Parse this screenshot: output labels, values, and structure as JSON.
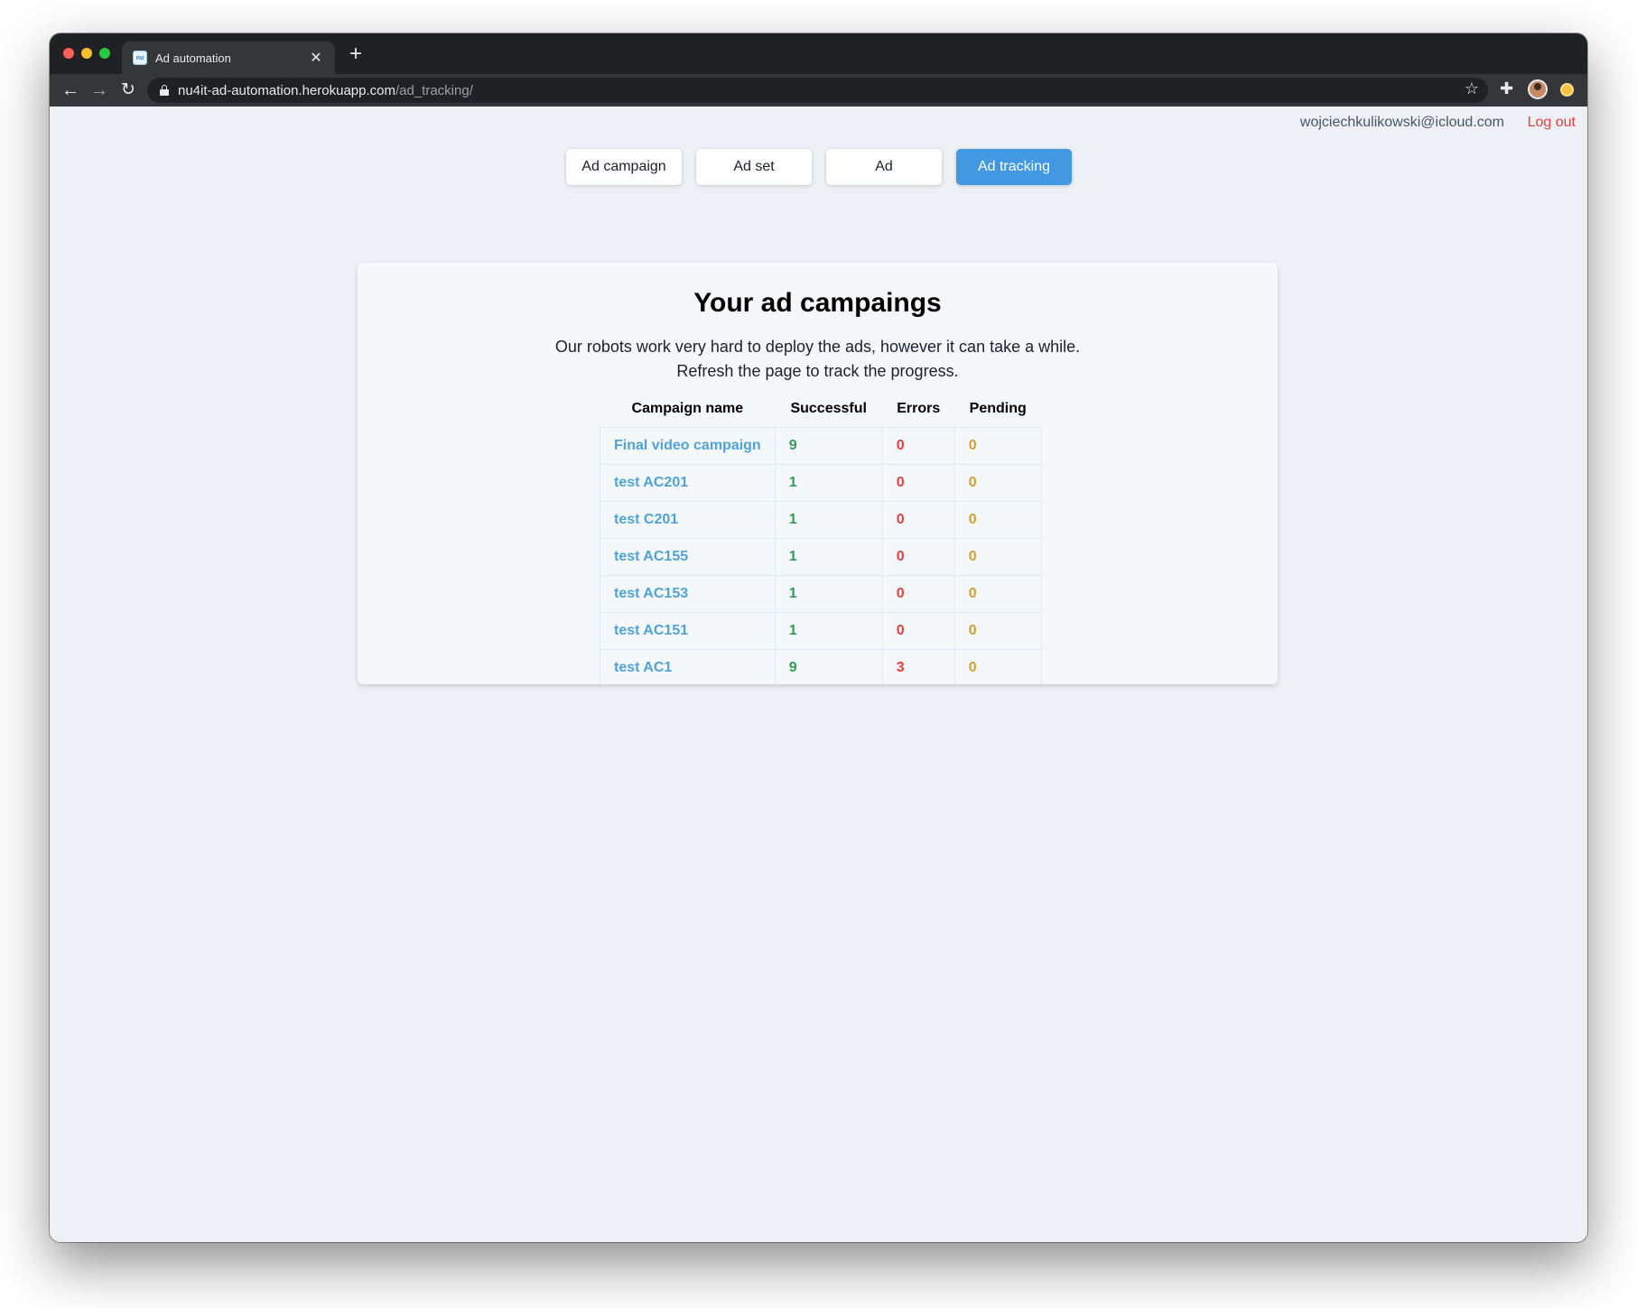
{
  "browser": {
    "tab_title": "Ad automation",
    "favicon_text": "nu",
    "url_host": "nu4it-ad-automation.herokuapp.com",
    "url_path": "/ad_tracking/"
  },
  "header": {
    "user_email": "wojciechkulikowski@icloud.com",
    "logout_label": "Log out"
  },
  "nav": {
    "ad_campaign": "Ad campaign",
    "ad_set": "Ad set",
    "ad": "Ad",
    "ad_tracking": "Ad tracking",
    "active": "ad_tracking"
  },
  "main": {
    "title": "Your ad campaings",
    "description_line1": "Our robots work very hard to deploy the ads, however it can take a while.",
    "description_line2": "Refresh the page to track the progress."
  },
  "table": {
    "headers": [
      "Campaign name",
      "Successful",
      "Errors",
      "Pending"
    ],
    "rows": [
      {
        "name": "Final video campaign",
        "successful": "9",
        "errors": "0",
        "pending": "0"
      },
      {
        "name": "test AC201",
        "successful": "1",
        "errors": "0",
        "pending": "0"
      },
      {
        "name": "test C201",
        "successful": "1",
        "errors": "0",
        "pending": "0"
      },
      {
        "name": "test AC155",
        "successful": "1",
        "errors": "0",
        "pending": "0"
      },
      {
        "name": "test AC153",
        "successful": "1",
        "errors": "0",
        "pending": "0"
      },
      {
        "name": "test AC151",
        "successful": "1",
        "errors": "0",
        "pending": "0"
      },
      {
        "name": "test AC1",
        "successful": "9",
        "errors": "3",
        "pending": "0"
      }
    ]
  },
  "colors": {
    "accent": "#4299e1",
    "link": "#4fa3d9",
    "success": "#2f9e54",
    "error": "#e53e3e",
    "pending": "#d69e2e"
  }
}
